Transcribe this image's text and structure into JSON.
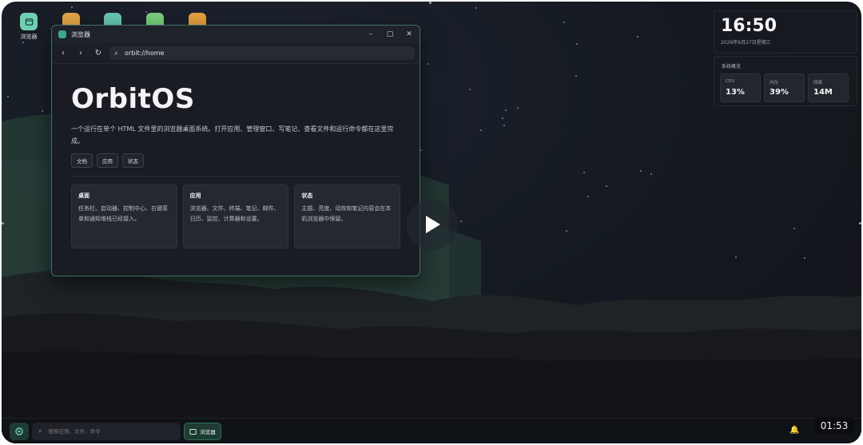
{
  "desktop_icons": [
    {
      "label": "浏览器",
      "color": "#6fd1b3",
      "icon": "browser-icon"
    },
    {
      "label": "",
      "color": "#e7a648",
      "icon": "app-icon"
    },
    {
      "label": "",
      "color": "#67c9b2",
      "icon": "app-icon"
    },
    {
      "label": "",
      "color": "#7ad07e",
      "icon": "app-icon"
    },
    {
      "label": "",
      "color": "#e8a241",
      "icon": "app-icon"
    }
  ],
  "window": {
    "title": "浏览器",
    "url": "orbit://home",
    "hero_title": "OrbitOS",
    "hero_desc": "一个运行在单个 HTML 文件里的浏览器桌面系统。打开应用、管理窗口、写笔记、查看文件和运行命令都在这里完成。",
    "chips": [
      "文档",
      "应用",
      "状态"
    ],
    "cards": [
      {
        "title": "桌面",
        "body": "任务栏、启动器、控制中心、右键菜单和通知堆栈已经接入。"
      },
      {
        "title": "应用",
        "body": "浏览器、文件、终端、笔记、邮件、日历、监控、计算器和设置。"
      },
      {
        "title": "状态",
        "body": "主题、亮度、动效和笔记内容会在本机浏览器中保留。"
      }
    ]
  },
  "clock": {
    "time": "16:50",
    "date": "2026年6月27日星期三"
  },
  "system": {
    "title": "系统概览",
    "stats": [
      {
        "label": "CPU",
        "value": "13%"
      },
      {
        "label": "内存",
        "value": "39%"
      },
      {
        "label": "网络",
        "value": "14M"
      }
    ]
  },
  "taskbar": {
    "search_placeholder": "搜索应用、文件、命令",
    "task_label": "浏览器"
  },
  "video": {
    "duration": "01:53"
  },
  "colors": {
    "accent": "#3aa98b",
    "border": "#78d2be"
  }
}
